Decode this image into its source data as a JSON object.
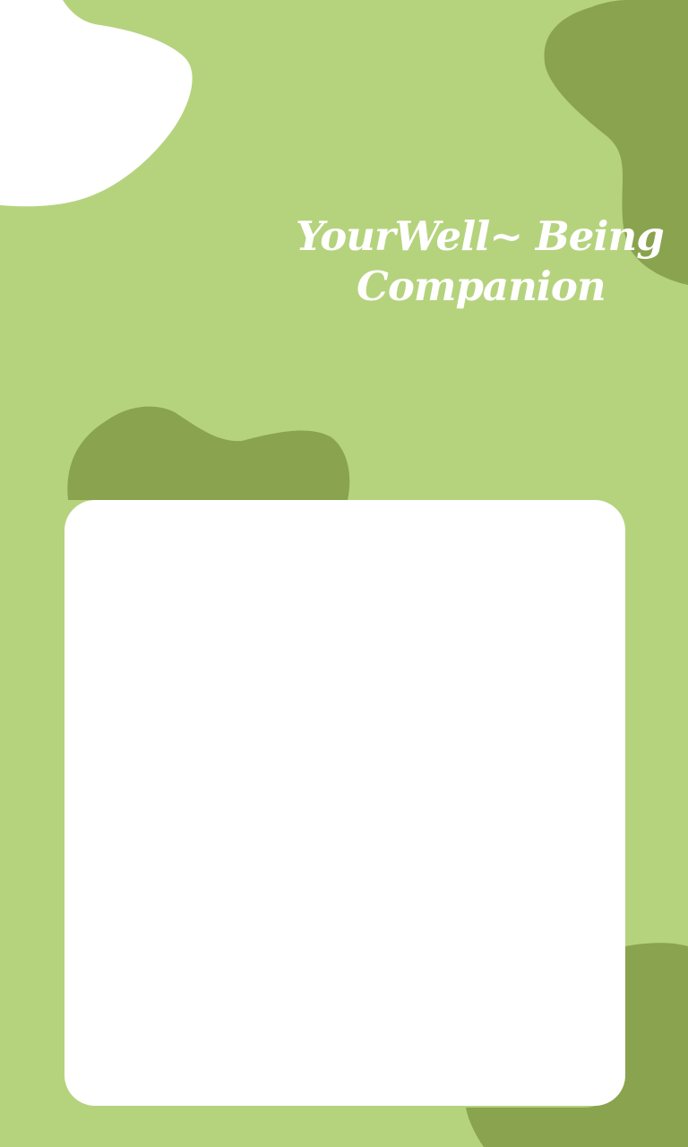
{
  "colors": {
    "background": "#b5d37d",
    "blob": "#8aa34e",
    "white": "#ffffff"
  },
  "tagline": {
    "line1": "YourWell~ Being",
    "line2": "Companion"
  }
}
